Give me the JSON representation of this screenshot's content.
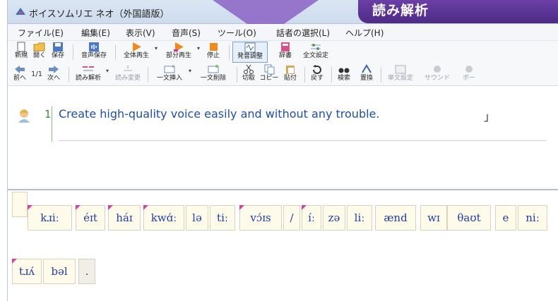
{
  "window": {
    "title": "ボイスソムリエ ネオ（外国語版）"
  },
  "banner": {
    "text": "読み解析"
  },
  "menu": [
    "ファイル(E)",
    "編集(E)",
    "表示(V)",
    "音声(S)",
    "ツール(O)",
    "話者の選択(L)",
    "ヘルプ(H)"
  ],
  "toolbar1": {
    "new": "新規",
    "open": "開く",
    "save": "保存",
    "save_audio": "音声保存",
    "play_all": "全体再生",
    "play_part": "部分再生",
    "stop": "停止",
    "adjust": "発音調整",
    "dict": "辞書",
    "settings": "全文設定"
  },
  "toolbar2": {
    "prev": "前へ",
    "page": "1/1",
    "next": "次へ",
    "read_analyze": "読み解析",
    "read_change": "読み変更",
    "insert_sentence": "一文挿入",
    "delete_sentence": "一文削除",
    "cut": "切取",
    "copy": "コピー",
    "paste": "貼付",
    "undo": "戻す",
    "search": "検索",
    "replace": "置換",
    "single_setting": "単文設定",
    "sound": "サウンド",
    "pause": "ポー"
  },
  "editor": {
    "line_number": "1",
    "sentence": "Create high-quality voice easily and without any trouble.",
    "cursor_mark": "」"
  },
  "phonetics": {
    "tokens": [
      {
        "text": ""
      },
      {
        "text": "kɹiː"
      },
      {
        "text": "éɪt"
      },
      {
        "text": "háɪ"
      },
      {
        "text": "kwɑ́ː"
      },
      {
        "text": "lə"
      },
      {
        "text": "tiː"
      },
      {
        "text": "vɔ́ɪs"
      },
      {
        "text": "/"
      },
      {
        "text": "íː"
      },
      {
        "text": "zə"
      },
      {
        "text": "liː"
      },
      {
        "text": "ænd"
      },
      {
        "text": "wɪ"
      },
      {
        "text": "θaʊt"
      },
      {
        "text": "e"
      },
      {
        "text": "niː"
      },
      {
        "text": "tɹʌ́"
      },
      {
        "text": "bəl"
      },
      {
        "text": "."
      }
    ]
  },
  "colors": {
    "banner": "#5a3196",
    "sentence": "#1f4fa8",
    "phonetic": "#1f3fa0",
    "accent_marker": "#d6409a"
  }
}
